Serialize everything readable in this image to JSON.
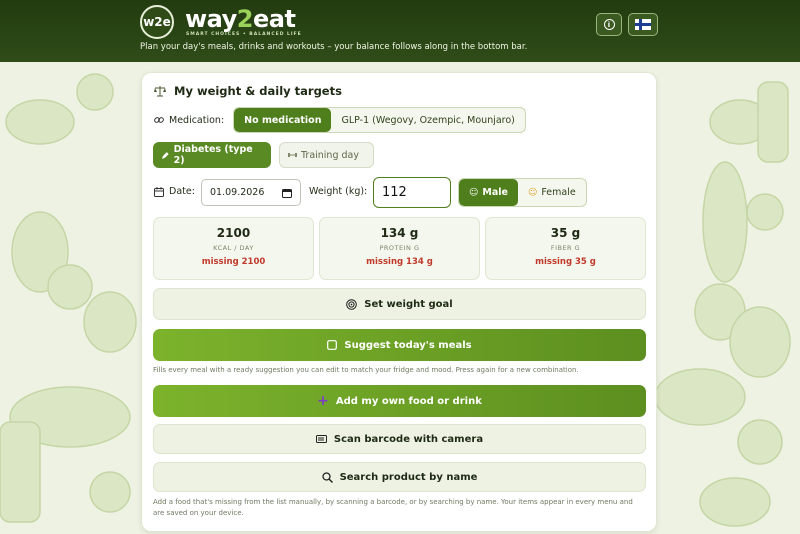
{
  "header": {
    "logo_mark": "w2e",
    "brand_prefix": "way",
    "brand_two": "2",
    "brand_suffix": "eat",
    "tagline": "SMART CHOICES • BALANCED LIFE",
    "subtitle": "Plan your day's meals, drinks and workouts – your balance follows along in the bottom bar.",
    "info_icon": "info-icon",
    "language_flag": "finland-flag-icon"
  },
  "card": {
    "title": "My weight & daily targets",
    "title_icon": "scale-icon",
    "medication": {
      "label": "Medication:",
      "options": [
        "No medication",
        "GLP-1 (Wegovy, Ozempic, Mounjaro)"
      ],
      "selected": "No medication"
    },
    "tags": {
      "diabetes": "Diabetes (type 2)",
      "training": "Training day"
    },
    "date": {
      "label": "Date:",
      "value": "01.09.2026"
    },
    "weight": {
      "label": "Weight (kg):",
      "value": "112"
    },
    "gender": {
      "options": [
        "Male",
        "Female"
      ],
      "selected": "Male"
    },
    "stats": [
      {
        "value": "2100",
        "unit": "KCAL / DAY",
        "missing": "missing 2100"
      },
      {
        "value": "134 g",
        "unit": "PROTEIN G",
        "missing": "missing 134 g"
      },
      {
        "value": "35 g",
        "unit": "FIBER G",
        "missing": "missing 35 g"
      }
    ],
    "set_goal_label": "Set weight goal",
    "suggest_label": "Suggest today's meals",
    "suggest_note": "Fills every meal with a ready suggestion you can edit to match your fridge and mood. Press again for a new combination.",
    "add_food_label": "Add my own food or drink",
    "scan_label": "Scan barcode with camera",
    "search_label": "Search product by name",
    "footer_note": "Add a food that's missing from the list manually, by scanning a barcode, or by searching by name. Your items appear in every menu and are saved on your device."
  },
  "colors": {
    "header_bg": "#2f4c18",
    "accent_green": "#4f7f1d",
    "missing_red": "#c0392b",
    "page_bg": "#eef2e3"
  }
}
